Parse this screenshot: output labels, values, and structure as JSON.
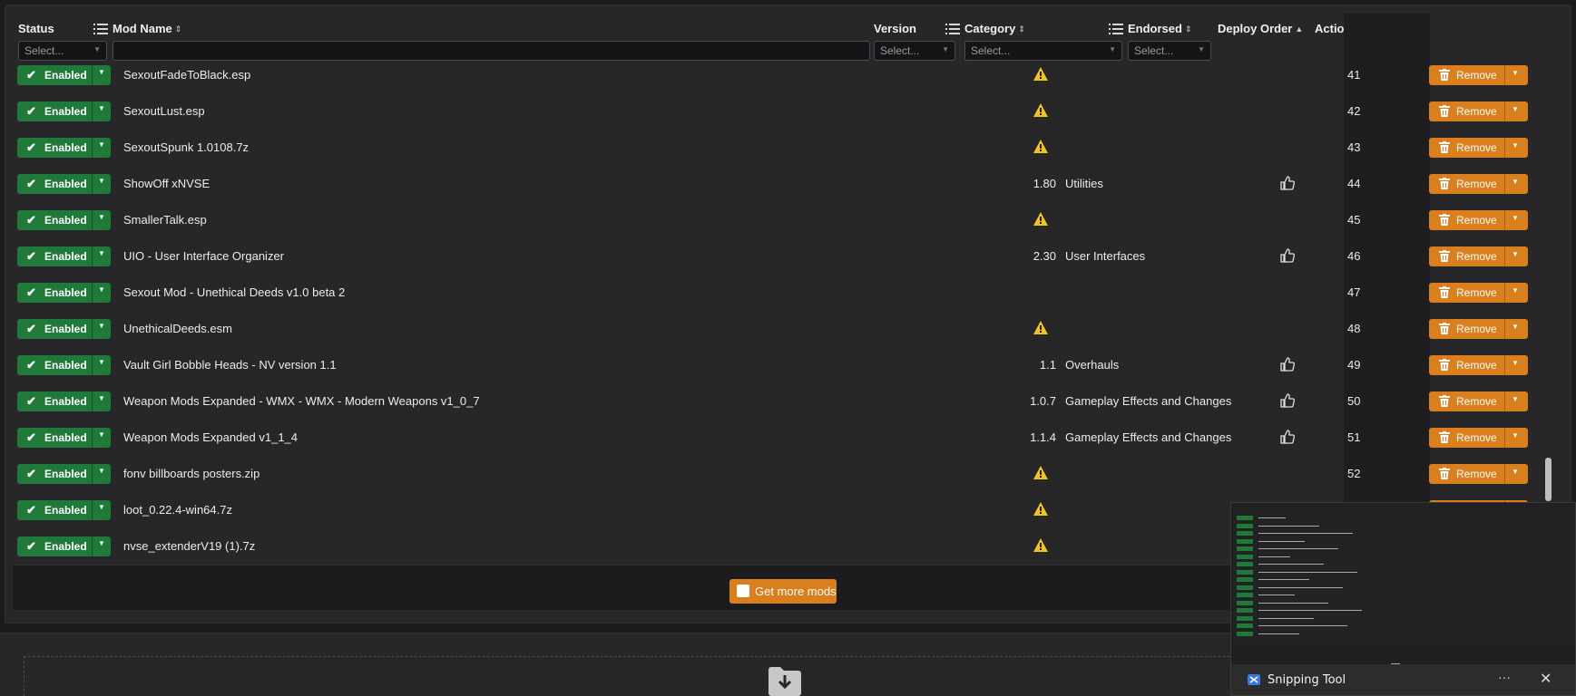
{
  "columns": {
    "status": "Status",
    "mod_name": "Mod Name",
    "version": "Version",
    "category": "Category",
    "endorsed": "Endorsed",
    "deploy_order": "Deploy Order",
    "actions": "Actions"
  },
  "filters": {
    "status_placeholder": "Select...",
    "version_placeholder": "Select...",
    "category_placeholder": "Select...",
    "endorsed_placeholder": "Select..."
  },
  "status_label": "Enabled",
  "remove_label": "Remove",
  "get_more_label": "Get more mods",
  "rows": [
    {
      "name": "SexoutFadeToBlack.esp",
      "version": "",
      "warning": true,
      "category": "",
      "endorsed": false,
      "order": "41"
    },
    {
      "name": "SexoutLust.esp",
      "version": "",
      "warning": true,
      "category": "",
      "endorsed": false,
      "order": "42"
    },
    {
      "name": "SexoutSpunk 1.0108.7z",
      "version": "",
      "warning": true,
      "category": "",
      "endorsed": false,
      "order": "43"
    },
    {
      "name": "ShowOff xNVSE",
      "version": "1.80",
      "warning": false,
      "category": "Utilities",
      "endorsed": true,
      "order": "44"
    },
    {
      "name": "SmallerTalk.esp",
      "version": "",
      "warning": true,
      "category": "",
      "endorsed": false,
      "order": "45"
    },
    {
      "name": "UIO - User Interface Organizer",
      "version": "2.30",
      "warning": false,
      "category": "User Interfaces",
      "endorsed": true,
      "order": "46"
    },
    {
      "name": "Sexout Mod - Unethical Deeds v1.0 beta 2",
      "version": "",
      "warning": false,
      "category": "",
      "endorsed": false,
      "order": "47"
    },
    {
      "name": "UnethicalDeeds.esm",
      "version": "",
      "warning": true,
      "category": "",
      "endorsed": false,
      "order": "48"
    },
    {
      "name": "Vault Girl Bobble Heads - NV version 1.1",
      "version": "1.1",
      "warning": false,
      "category": "Overhauls",
      "endorsed": true,
      "order": "49"
    },
    {
      "name": "Weapon Mods Expanded - WMX - WMX - Modern Weapons v1_0_7",
      "version": "1.0.7",
      "warning": false,
      "category": "Gameplay Effects and Changes",
      "endorsed": true,
      "order": "50"
    },
    {
      "name": "Weapon Mods Expanded v1_1_4",
      "version": "1.1.4",
      "warning": false,
      "category": "Gameplay Effects and Changes",
      "endorsed": true,
      "order": "51"
    },
    {
      "name": "fonv billboards posters.zip",
      "version": "",
      "warning": true,
      "category": "",
      "endorsed": false,
      "order": "52"
    },
    {
      "name": "loot_0.22.4-win64.7z",
      "version": "",
      "warning": true,
      "category": "",
      "endorsed": false,
      "order": ""
    },
    {
      "name": "nvse_extenderV19 (1).7z",
      "version": "",
      "warning": true,
      "category": "",
      "endorsed": false,
      "order": ""
    }
  ],
  "snipping_tool": {
    "title": "Snipping Tool",
    "more": "···",
    "close": "✕"
  },
  "colors": {
    "enabled": "#1f7a3a",
    "remove": "#d97f1e",
    "warning": "#f0c419"
  },
  "icons": [
    "check-icon",
    "dropdown-caret-icon",
    "warning-icon",
    "thumbs-up-icon",
    "trash-icon",
    "gear-icon",
    "list-icon",
    "download-icon"
  ]
}
